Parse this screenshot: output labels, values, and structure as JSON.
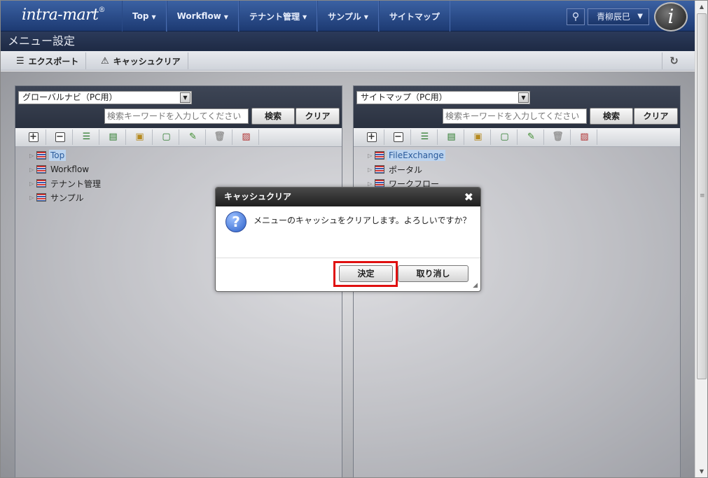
{
  "app": {
    "logo_text": "intra-mart",
    "logo_mark": "®"
  },
  "nav": {
    "items": [
      {
        "label": "Top",
        "caret": "▼"
      },
      {
        "label": "Workflow",
        "caret": "▼"
      },
      {
        "label": "テナント管理",
        "caret": "▼"
      },
      {
        "label": "サンプル",
        "caret": "▼"
      },
      {
        "label": "サイトマップ",
        "caret": ""
      }
    ],
    "user_name": "青柳辰巳",
    "badge_letter": "i"
  },
  "page": {
    "title": "メニュー設定"
  },
  "toolbar": {
    "export_label": "エクスポート",
    "cache_clear_label": "キャッシュクリア"
  },
  "left_panel": {
    "selected_option": "グローバルナビ（PC用）",
    "search_placeholder": "検索キーワードを入力してください",
    "search_label": "検索",
    "clear_label": "クリア",
    "nodes": [
      "Top",
      "Workflow",
      "テナント管理",
      "サンプル"
    ]
  },
  "right_panel": {
    "selected_option": "サイトマップ（PC用）",
    "search_placeholder": "検索キーワードを入力してください",
    "search_label": "検索",
    "clear_label": "クリア",
    "nodes": [
      "FileExchange",
      "ポータル",
      "ワークフロー"
    ]
  },
  "dialog": {
    "title": "キャッシュクリア",
    "message": "メニューのキャッシュをクリアします。よろしいですか？",
    "ok_label": "決定",
    "cancel_label": "取り消し"
  },
  "colors": {
    "nav_bg": "#2b4c8c",
    "highlight": "#e01010",
    "selected_node_bg": "#bcd4ef"
  }
}
